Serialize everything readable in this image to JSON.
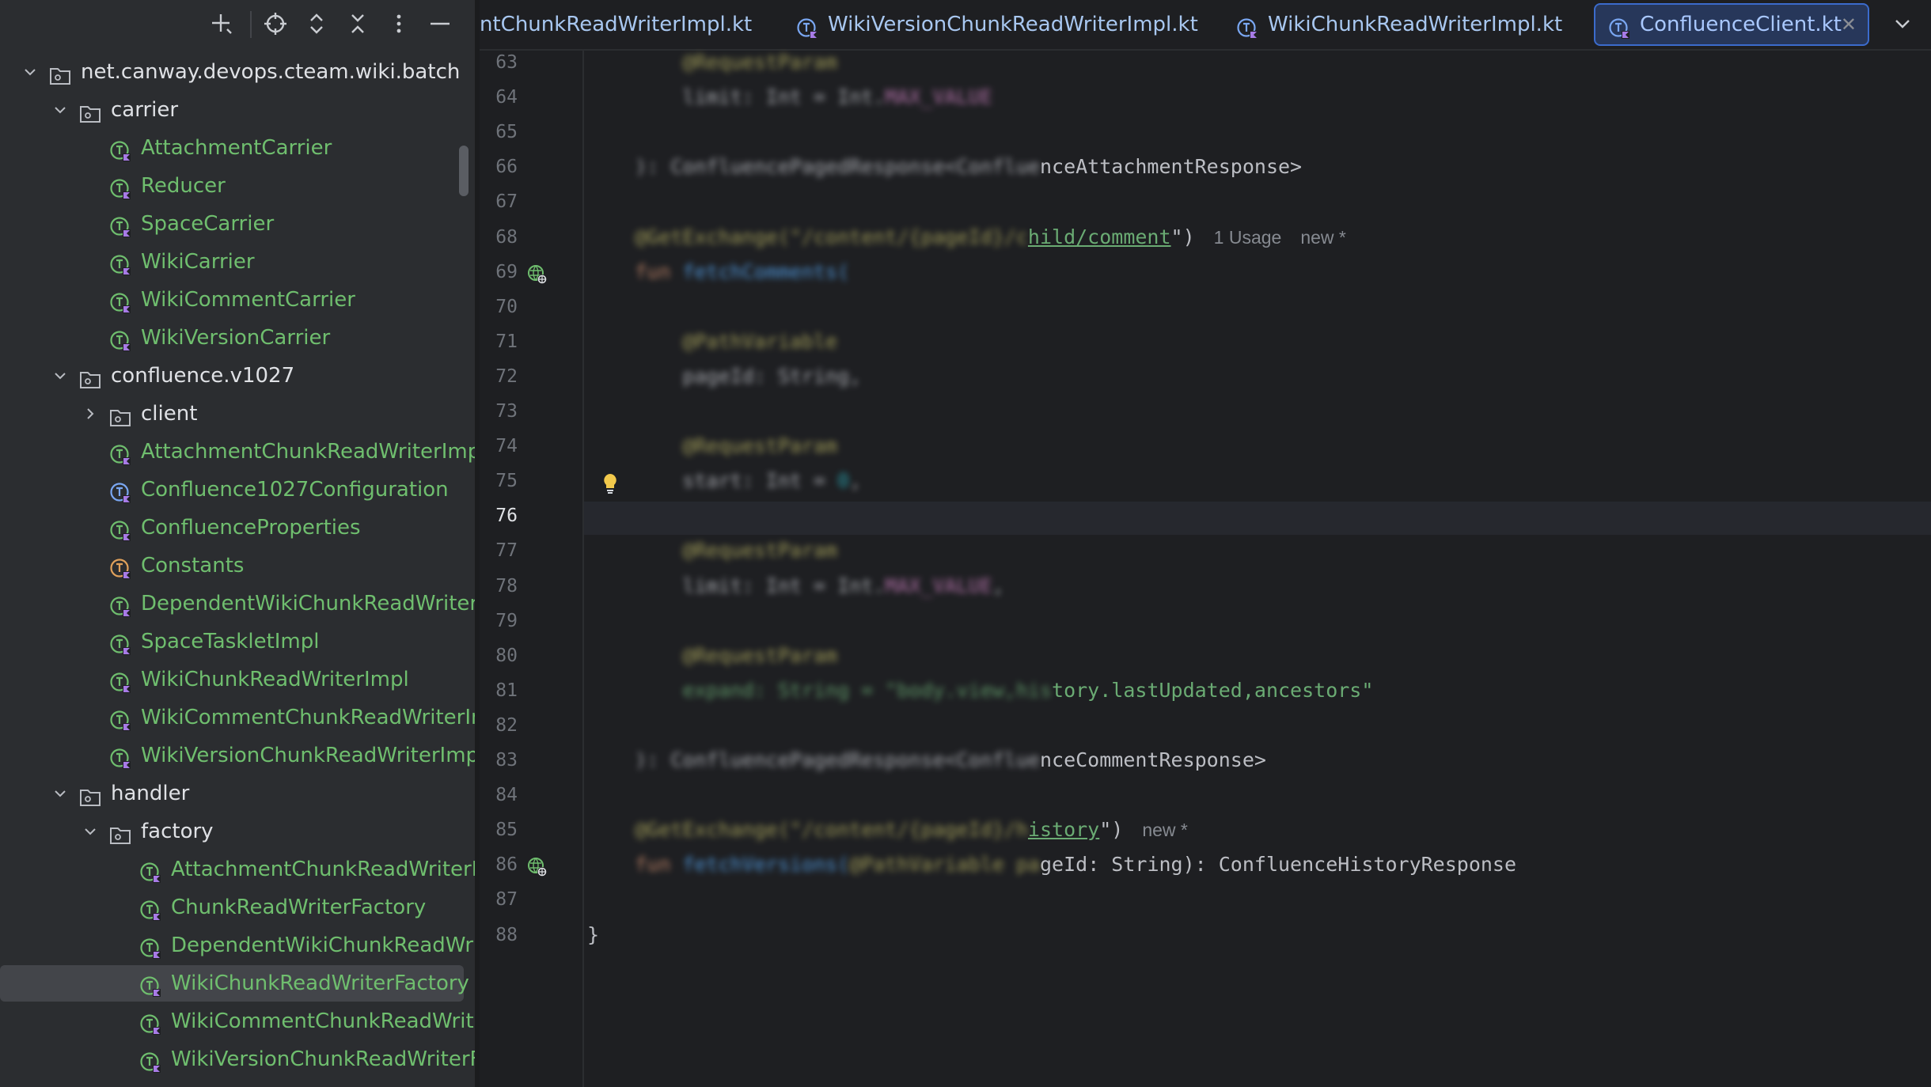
{
  "project_tree": {
    "rows": [
      {
        "label": "net.canway.devops.cteam.wiki.batch",
        "kind": "package",
        "expanded": true
      },
      {
        "label": "carrier",
        "kind": "package",
        "expanded": true
      },
      {
        "label": "AttachmentCarrier",
        "kind": "kotlin-class",
        "color": "green"
      },
      {
        "label": "Reducer",
        "kind": "kotlin-class",
        "color": "green"
      },
      {
        "label": "SpaceCarrier",
        "kind": "kotlin-class",
        "color": "green"
      },
      {
        "label": "WikiCarrier",
        "kind": "kotlin-class",
        "color": "green"
      },
      {
        "label": "WikiCommentCarrier",
        "kind": "kotlin-class",
        "color": "green"
      },
      {
        "label": "WikiVersionCarrier",
        "kind": "kotlin-class",
        "color": "green"
      },
      {
        "label": "confluence.v1027",
        "kind": "package",
        "expanded": true
      },
      {
        "label": "client",
        "kind": "package",
        "expanded": false
      },
      {
        "label": "AttachmentChunkReadWriterImpl",
        "kind": "kotlin-class",
        "color": "green"
      },
      {
        "label": "Confluence1027Configuration",
        "kind": "kotlin-class",
        "color": "blue"
      },
      {
        "label": "ConfluenceProperties",
        "kind": "kotlin-class",
        "color": "green"
      },
      {
        "label": "Constants",
        "kind": "kotlin-object",
        "color": "green"
      },
      {
        "label": "DependentWikiChunkReadWriterIm",
        "kind": "kotlin-class",
        "color": "green"
      },
      {
        "label": "SpaceTaskletImpl",
        "kind": "kotlin-class",
        "color": "green"
      },
      {
        "label": "WikiChunkReadWriterImpl",
        "kind": "kotlin-class",
        "color": "green"
      },
      {
        "label": "WikiCommentChunkReadWriterImp",
        "kind": "kotlin-class",
        "color": "green"
      },
      {
        "label": "WikiVersionChunkReadWriterImpl",
        "kind": "kotlin-class",
        "color": "green"
      },
      {
        "label": "handler",
        "kind": "package",
        "expanded": true
      },
      {
        "label": "factory",
        "kind": "package",
        "expanded": true
      },
      {
        "label": "AttachmentChunkReadWriterFa",
        "kind": "kotlin-class",
        "color": "green"
      },
      {
        "label": "ChunkReadWriterFactory",
        "kind": "kotlin-class",
        "color": "green"
      },
      {
        "label": "DependentWikiChunkReadWrite",
        "kind": "kotlin-class",
        "color": "green"
      },
      {
        "label": "WikiChunkReadWriterFactory",
        "kind": "kotlin-class",
        "color": "green",
        "selected": true
      },
      {
        "label": "WikiCommentChunkReadWriter",
        "kind": "kotlin-class",
        "color": "green"
      },
      {
        "label": "WikiVersionChunkReadWriterFa",
        "kind": "kotlin-class",
        "color": "green"
      }
    ]
  },
  "toolbar": {
    "icons": [
      "new-file-icon",
      "locate-icon",
      "expand-all-icon",
      "collapse-all-icon",
      "more-options-icon",
      "minimize-icon"
    ]
  },
  "tabs": [
    {
      "label": "ntChunkReadWriterImpl.kt",
      "active": false
    },
    {
      "label": "WikiVersionChunkReadWriterImpl.kt",
      "active": false
    },
    {
      "label": "WikiChunkReadWriterImpl.kt",
      "active": false
    },
    {
      "label": "ConfluenceClient.kt",
      "active": true,
      "close": "✕"
    }
  ],
  "editor": {
    "current_line": 76,
    "lines": [
      {
        "n": 63,
        "segments": [
          {
            "t": "        ",
            "c": "plain"
          },
          {
            "t": "@RequestParam",
            "c": "ann",
            "blur": true
          }
        ]
      },
      {
        "n": 64,
        "segments": [
          {
            "t": "        ",
            "c": "plain"
          },
          {
            "t": "limit: Int = Int.",
            "c": "plain",
            "blur": true
          },
          {
            "t": "MAX_VALUE",
            "c": "purple",
            "blur": true
          }
        ]
      },
      {
        "n": 65,
        "segments": []
      },
      {
        "n": 66,
        "segments": [
          {
            "t": "    ",
            "c": "plain"
          },
          {
            "t": "): ConfluencePagedResponse<Conflue",
            "c": "plain",
            "blur": true
          },
          {
            "t": "nceAttachmentResponse>",
            "c": "plain"
          }
        ]
      },
      {
        "n": 67,
        "segments": []
      },
      {
        "n": 68,
        "segments": [
          {
            "t": "    ",
            "c": "plain"
          },
          {
            "t": "@GetExchange(\"/content/{pageId}/c",
            "c": "ann",
            "blur": true
          },
          {
            "t": "hild/comment",
            "c": "link"
          },
          {
            "t": "\")",
            "c": "plain"
          }
        ],
        "inlay": [
          "1 Usage",
          "new *"
        ]
      },
      {
        "n": 69,
        "segments": [
          {
            "t": "    ",
            "c": "plain"
          },
          {
            "t": "fun ",
            "c": "kw",
            "blur": true
          },
          {
            "t": "fetchComments(",
            "c": "fn",
            "blur": true
          }
        ]
      },
      {
        "n": 70,
        "segments": []
      },
      {
        "n": 71,
        "segments": [
          {
            "t": "        ",
            "c": "plain"
          },
          {
            "t": "@PathVariable",
            "c": "ann",
            "blur": true
          }
        ]
      },
      {
        "n": 72,
        "segments": [
          {
            "t": "        ",
            "c": "plain"
          },
          {
            "t": "pageId: String,",
            "c": "plain",
            "blur": true
          }
        ]
      },
      {
        "n": 73,
        "segments": []
      },
      {
        "n": 74,
        "segments": [
          {
            "t": "        ",
            "c": "plain"
          },
          {
            "t": "@RequestParam",
            "c": "ann",
            "blur": true
          }
        ]
      },
      {
        "n": 75,
        "segments": [
          {
            "t": "        ",
            "c": "plain"
          },
          {
            "t": "start: Int = ",
            "c": "plain",
            "blur": true
          },
          {
            "t": "0",
            "c": "num",
            "blur": true
          },
          {
            "t": ",",
            "c": "plain",
            "blur": true
          }
        ]
      },
      {
        "n": 76,
        "segments": []
      },
      {
        "n": 77,
        "segments": [
          {
            "t": "        ",
            "c": "plain"
          },
          {
            "t": "@RequestParam",
            "c": "ann",
            "blur": true
          }
        ]
      },
      {
        "n": 78,
        "segments": [
          {
            "t": "        ",
            "c": "plain"
          },
          {
            "t": "limit: Int = Int.",
            "c": "plain",
            "blur": true
          },
          {
            "t": "MAX_VALUE",
            "c": "purple",
            "blur": true
          },
          {
            "t": ",",
            "c": "plain",
            "blur": true
          }
        ]
      },
      {
        "n": 79,
        "segments": []
      },
      {
        "n": 80,
        "segments": [
          {
            "t": "        ",
            "c": "plain"
          },
          {
            "t": "@RequestParam",
            "c": "ann",
            "blur": true
          }
        ]
      },
      {
        "n": 81,
        "segments": [
          {
            "t": "        ",
            "c": "plain"
          },
          {
            "t": "expand: String = \"body.view,his",
            "c": "str",
            "blur": true
          },
          {
            "t": "tory.lastUpdated,ancestors\"",
            "c": "str"
          }
        ]
      },
      {
        "n": 82,
        "segments": []
      },
      {
        "n": 83,
        "segments": [
          {
            "t": "    ",
            "c": "plain"
          },
          {
            "t": "): ConfluencePagedResponse<Conflue",
            "c": "plain",
            "blur": true
          },
          {
            "t": "nceCommentResponse>",
            "c": "plain"
          }
        ]
      },
      {
        "n": 84,
        "segments": []
      },
      {
        "n": 85,
        "segments": [
          {
            "t": "    ",
            "c": "plain"
          },
          {
            "t": "@GetExchange(\"/content/{pageId}/h",
            "c": "ann",
            "blur": true
          },
          {
            "t": "istory",
            "c": "link"
          },
          {
            "t": "\")",
            "c": "plain"
          }
        ],
        "inlay": [
          "new *"
        ]
      },
      {
        "n": 86,
        "segments": [
          {
            "t": "    ",
            "c": "plain"
          },
          {
            "t": "fun ",
            "c": "kw",
            "blur": true
          },
          {
            "t": "fetchVersions(",
            "c": "fn",
            "blur": true
          },
          {
            "t": "@PathVariable pa",
            "c": "ann",
            "blur": true
          },
          {
            "t": "geId: String): ConfluenceHistoryResponse",
            "c": "plain"
          }
        ]
      },
      {
        "n": 87,
        "segments": []
      },
      {
        "n": 88,
        "segments": [
          {
            "t": "}",
            "c": "plain"
          }
        ]
      }
    ]
  },
  "colors": {
    "accent": "#3b6bcc",
    "kotlin_green": "#6fbe6e",
    "kotlin_blue": "#7aa7f2"
  }
}
